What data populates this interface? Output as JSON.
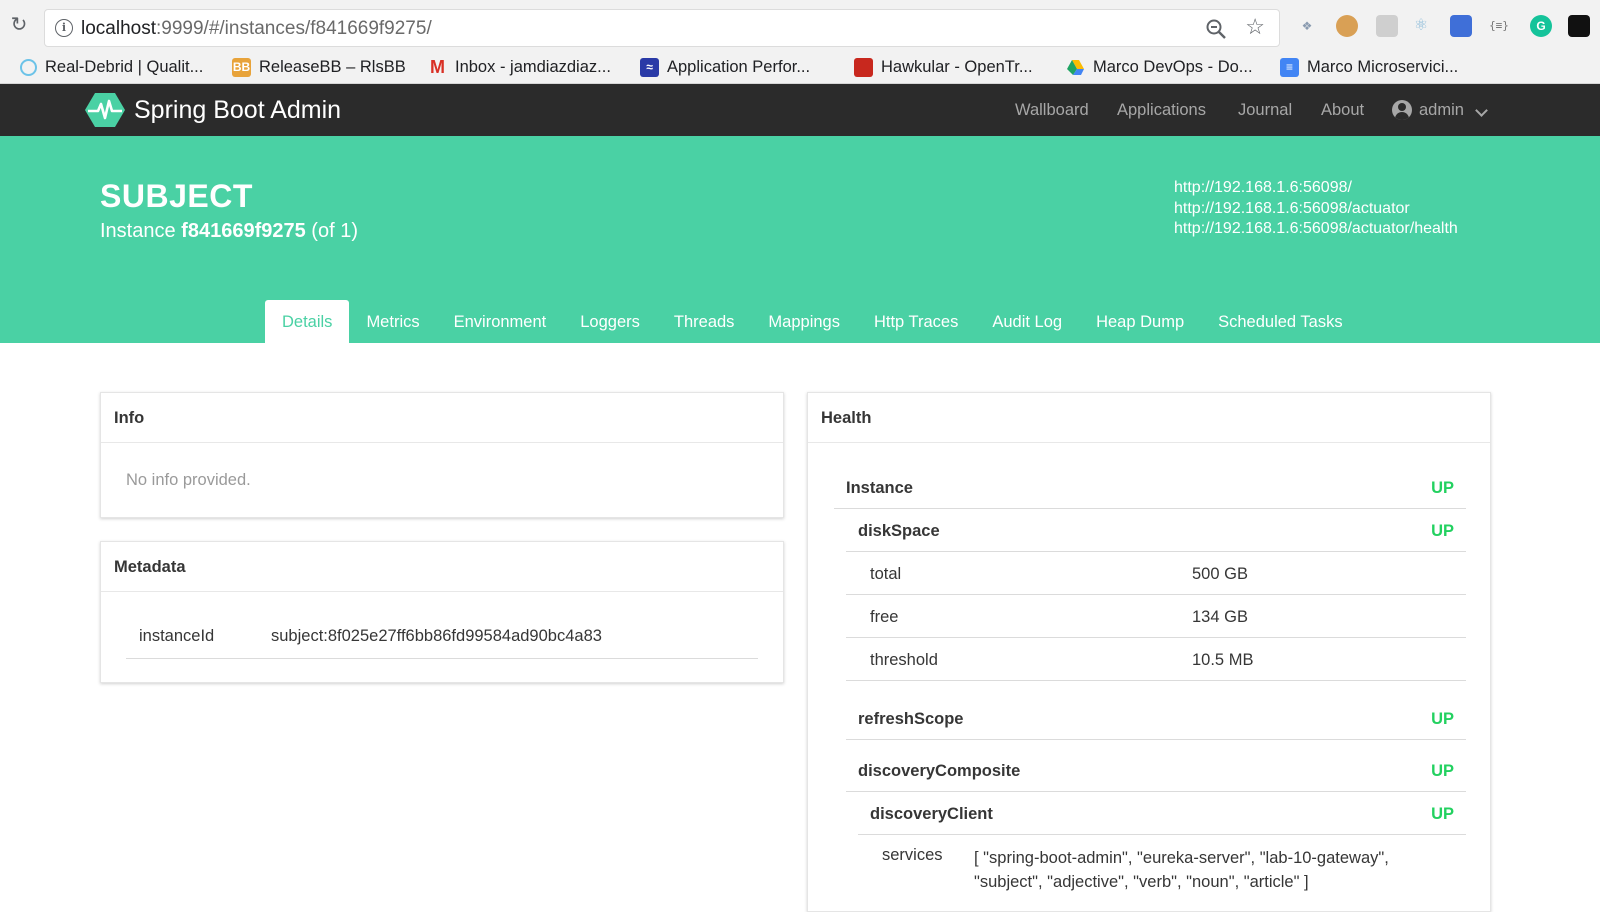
{
  "browser": {
    "url_host": "localhost",
    "url_rest": ":9999/#/instances/f841669f9275/",
    "bookmarks": [
      {
        "label": "Real-Debrid | Qualit...",
        "icon": "real-debrid-icon",
        "color": "#6cc3e8"
      },
      {
        "label": "ReleaseBB – RlsBB",
        "icon": "releasebb-icon",
        "color": "#e8a33a"
      },
      {
        "label": "Inbox - jamdiazdiaz...",
        "icon": "gmail-icon",
        "color": "#d93025"
      },
      {
        "label": "Application Perfor...",
        "icon": "app-performance-icon",
        "color": "#2a3aa7"
      },
      {
        "label": "Hawkular - OpenTr...",
        "icon": "hawkular-icon",
        "color": "#c8281e"
      },
      {
        "label": "Marco DevOps - Do...",
        "icon": "google-drive-icon",
        "color": "#1fa463"
      },
      {
        "label": "Marco Microservici...",
        "icon": "google-docs-icon",
        "color": "#4285f4"
      }
    ]
  },
  "navbar": {
    "brand": "Spring Boot Admin",
    "links": [
      "Wallboard",
      "Applications",
      "Journal",
      "About"
    ],
    "user": "admin"
  },
  "hero": {
    "title": "SUBJECT",
    "instance_prefix": "Instance",
    "instance_id": "f841669f9275",
    "instance_suffix": "(of 1)",
    "links": [
      "http://192.168.1.6:56098/",
      "http://192.168.1.6:56098/actuator",
      "http://192.168.1.6:56098/actuator/health"
    ]
  },
  "tabs": [
    "Details",
    "Metrics",
    "Environment",
    "Loggers",
    "Threads",
    "Mappings",
    "Http Traces",
    "Audit Log",
    "Heap Dump",
    "Scheduled Tasks"
  ],
  "active_tab": "Details",
  "info": {
    "title": "Info",
    "empty_text": "No info provided."
  },
  "metadata": {
    "title": "Metadata",
    "key": "instanceId",
    "value": "subject:8f025e27ff6bb86fd99584ad90bc4a83"
  },
  "health": {
    "title": "Health",
    "instance_label": "Instance",
    "instance_status": "UP",
    "disk_space": {
      "label": "diskSpace",
      "status": "UP",
      "details": [
        {
          "key": "total",
          "value": "500 GB"
        },
        {
          "key": "free",
          "value": "134 GB"
        },
        {
          "key": "threshold",
          "value": "10.5 MB"
        }
      ]
    },
    "refresh_scope": {
      "label": "refreshScope",
      "status": "UP"
    },
    "discovery_composite": {
      "label": "discoveryComposite",
      "status": "UP"
    },
    "discovery_client": {
      "label": "discoveryClient",
      "status": "UP"
    },
    "services_key": "services",
    "services_value": "[ \"spring-boot-admin\", \"eureka-server\", \"lab-10-gateway\", \"subject\", \"adjective\", \"verb\", \"noun\", \"article\" ]"
  },
  "colors": {
    "accent": "#4ad1a4",
    "navbar": "#2b2b2b",
    "status_up": "#23d160"
  }
}
